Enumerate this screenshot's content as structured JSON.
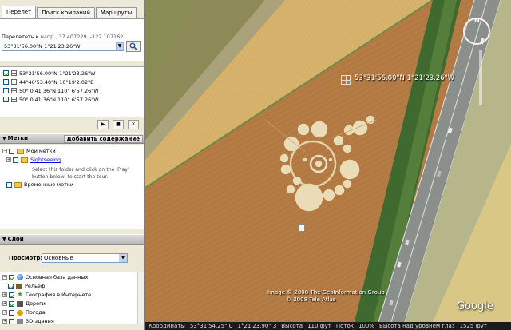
{
  "tabs": [
    {
      "label": "Перелет"
    },
    {
      "label": "Поиск компаний"
    },
    {
      "label": "Маршруты"
    }
  ],
  "fly_to": {
    "label": "Перелететь к",
    "hint": "напр., 37.407229, -122.107162",
    "value": "53°31'56.00\"N 1°21'23.26\"W"
  },
  "search_results": [
    {
      "checked": true,
      "text": "53°31'56.00\"N 1°21'23.26\"W"
    },
    {
      "checked": false,
      "text": "44°40'53.40\"N 10°19'2.02\"E"
    },
    {
      "checked": false,
      "text": "50° 0'41.36\"N 110° 6'57.26\"W"
    },
    {
      "checked": false,
      "text": "50° 0'41.36\"N 110° 6'57.26\"W"
    }
  ],
  "controls": {
    "play": "▶",
    "stop": "■",
    "close": "✕"
  },
  "places_panel": {
    "title": "Метки",
    "add_content": "Добавить содержание",
    "my_places": "Мои метки",
    "sightseeing": "Sightseeing",
    "sightseeing_note": "Select this folder and click on the 'Play' button below, to start the tour.",
    "temporary": "Временные метки"
  },
  "layers_panel": {
    "title": "Слои",
    "view_label": "Просмотр:",
    "view_value": "Основные",
    "items": [
      {
        "label": "Основная база данных",
        "checked": true,
        "icon": "globe-icon",
        "color": "#3a7fd5"
      },
      {
        "label": "Рельеф",
        "checked": true,
        "icon": "terrain-icon",
        "color": "#7a5b2f"
      },
      {
        "label": "География в Интернете",
        "checked": true,
        "icon": "star-icon",
        "color": "#2fa33b"
      },
      {
        "label": "Дороги",
        "checked": true,
        "icon": "road-icon",
        "color": "#555555"
      },
      {
        "label": "Погода",
        "checked": false,
        "icon": "weather-icon",
        "color": "#e0a000"
      },
      {
        "label": "3D-здания",
        "checked": false,
        "icon": "building-icon",
        "color": "#888888"
      }
    ]
  },
  "map": {
    "placemark_label": "53°31'56.00\"N 1°21'23.26\"W",
    "copyright_line1": "Image © 2008 The GeoInformation Group",
    "copyright_line2": "© 2008 Tele Atlas",
    "logo": "Google",
    "compass_n": "N"
  },
  "status_bar": {
    "coords_label": "Координаты",
    "lat": "53°31'54.25\" С",
    "lon": "1°21'23.90\" З",
    "elev_label": "Высота",
    "elev": "110 фут",
    "stream_label": "Поток",
    "stream": "100%",
    "eye_label": "Высота над уровнем глаз",
    "eye": "1525 фут"
  }
}
